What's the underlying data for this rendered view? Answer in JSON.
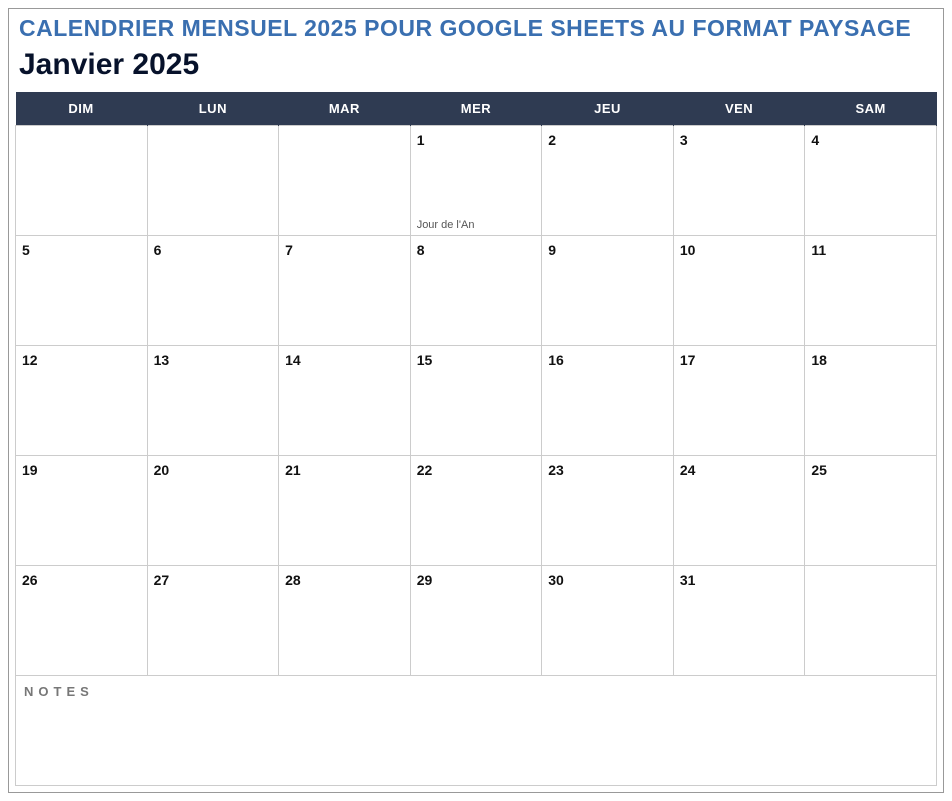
{
  "main_title": "CALENDRIER MENSUEL 2025 POUR GOOGLE SHEETS AU FORMAT PAYSAGE",
  "month_title": "Janvier 2025",
  "weekdays": [
    "DIM",
    "LUN",
    "MAR",
    "MER",
    "JEU",
    "VEN",
    "SAM"
  ],
  "rows": [
    [
      {
        "day": "",
        "note": "",
        "out": true
      },
      {
        "day": "",
        "note": "",
        "out": true
      },
      {
        "day": "",
        "note": "",
        "out": true
      },
      {
        "day": "1",
        "note": "Jour de l'An",
        "out": false
      },
      {
        "day": "2",
        "note": "",
        "out": false
      },
      {
        "day": "3",
        "note": "",
        "out": false
      },
      {
        "day": "4",
        "note": "",
        "out": false
      }
    ],
    [
      {
        "day": "5",
        "note": "",
        "out": false
      },
      {
        "day": "6",
        "note": "",
        "out": false
      },
      {
        "day": "7",
        "note": "",
        "out": false
      },
      {
        "day": "8",
        "note": "",
        "out": false
      },
      {
        "day": "9",
        "note": "",
        "out": false
      },
      {
        "day": "10",
        "note": "",
        "out": false
      },
      {
        "day": "11",
        "note": "",
        "out": false
      }
    ],
    [
      {
        "day": "12",
        "note": "",
        "out": false
      },
      {
        "day": "13",
        "note": "",
        "out": false
      },
      {
        "day": "14",
        "note": "",
        "out": false
      },
      {
        "day": "15",
        "note": "",
        "out": false
      },
      {
        "day": "16",
        "note": "",
        "out": false
      },
      {
        "day": "17",
        "note": "",
        "out": false
      },
      {
        "day": "18",
        "note": "",
        "out": false
      }
    ],
    [
      {
        "day": "19",
        "note": "",
        "out": false
      },
      {
        "day": "20",
        "note": "",
        "out": false
      },
      {
        "day": "21",
        "note": "",
        "out": false
      },
      {
        "day": "22",
        "note": "",
        "out": false
      },
      {
        "day": "23",
        "note": "",
        "out": false
      },
      {
        "day": "24",
        "note": "",
        "out": false
      },
      {
        "day": "25",
        "note": "",
        "out": false
      }
    ],
    [
      {
        "day": "26",
        "note": "",
        "out": false
      },
      {
        "day": "27",
        "note": "",
        "out": false
      },
      {
        "day": "28",
        "note": "",
        "out": false
      },
      {
        "day": "29",
        "note": "",
        "out": false
      },
      {
        "day": "30",
        "note": "",
        "out": false
      },
      {
        "day": "31",
        "note": "",
        "out": false
      },
      {
        "day": "",
        "note": "",
        "out": true
      }
    ]
  ],
  "notes_label": "NOTES"
}
